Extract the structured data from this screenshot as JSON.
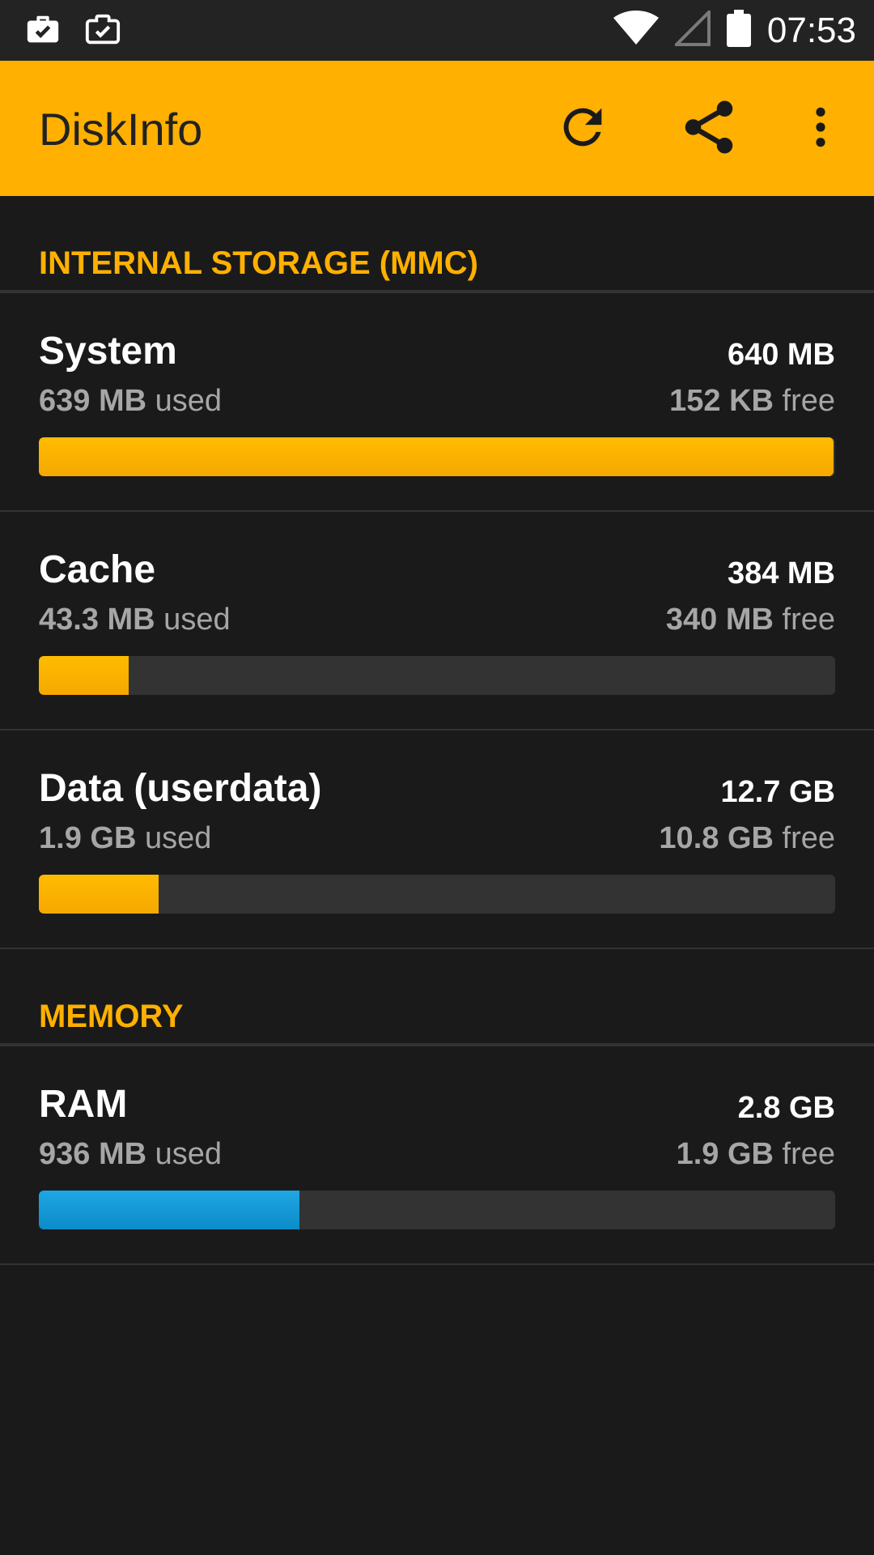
{
  "status_bar": {
    "time": "07:53",
    "left_icons": [
      "briefcase-check-icon",
      "clipboard-check-icon"
    ],
    "right_icons": [
      "wifi-icon",
      "cell-signal-icon",
      "battery-icon"
    ]
  },
  "app_bar": {
    "title": "DiskInfo",
    "background": "#ffb000",
    "actions": [
      "refresh-icon",
      "share-icon",
      "more-vert-icon"
    ]
  },
  "sections": {
    "internal": {
      "title": "INTERNAL STORAGE (MMC)",
      "items": [
        {
          "name": "System",
          "total": "640 MB",
          "used_value": "639 MB",
          "used_suffix": " used",
          "free_value": "152 KB",
          "free_suffix": " free",
          "fraction": 0.998,
          "color": "#ffb000"
        },
        {
          "name": "Cache",
          "total": "384 MB",
          "used_value": "43.3 MB",
          "used_suffix": " used",
          "free_value": "340 MB",
          "free_suffix": " free",
          "fraction": 0.113,
          "color": "#ffb000"
        },
        {
          "name": "Data (userdata)",
          "total": "12.7 GB",
          "used_value": "1.9 GB",
          "used_suffix": " used",
          "free_value": "10.8 GB",
          "free_suffix": " free",
          "fraction": 0.15,
          "color": "#ffb000"
        }
      ]
    },
    "memory": {
      "title": "MEMORY",
      "items": [
        {
          "name": "RAM",
          "total": "2.8 GB",
          "used_value": "936 MB",
          "used_suffix": " used",
          "free_value": "1.9 GB",
          "free_suffix": " free",
          "fraction": 0.327,
          "color": "#1e9fdc"
        }
      ]
    }
  }
}
